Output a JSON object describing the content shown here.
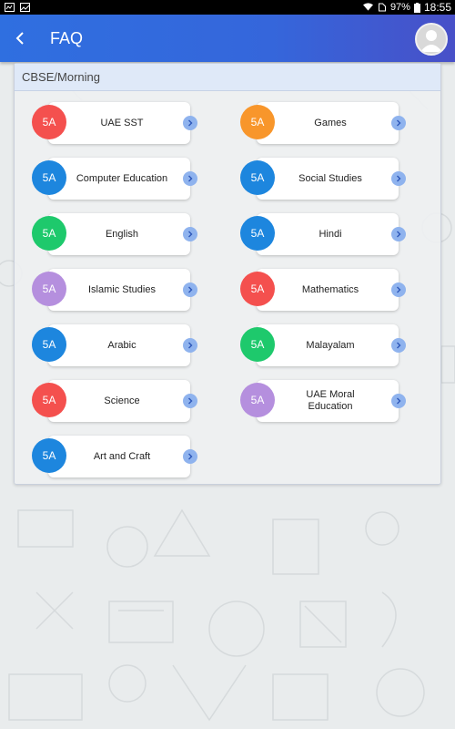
{
  "status_bar": {
    "battery": "97%",
    "time": "18:55"
  },
  "header": {
    "title": "FAQ"
  },
  "section": {
    "title": "CBSE/Morning"
  },
  "subjects": [
    {
      "class": "5A",
      "name": "UAE SST",
      "color": "#f4504e"
    },
    {
      "class": "5A",
      "name": "Games",
      "color": "#f8962b"
    },
    {
      "class": "5A",
      "name": "Computer Education",
      "color": "#1d86de"
    },
    {
      "class": "5A",
      "name": "Social Studies",
      "color": "#1d86de"
    },
    {
      "class": "5A",
      "name": "English",
      "color": "#1ec96c"
    },
    {
      "class": "5A",
      "name": "Hindi",
      "color": "#1d86de"
    },
    {
      "class": "5A",
      "name": "Islamic Studies",
      "color": "#b58fde"
    },
    {
      "class": "5A",
      "name": "Mathematics",
      "color": "#f4504e"
    },
    {
      "class": "5A",
      "name": "Arabic",
      "color": "#1d86de"
    },
    {
      "class": "5A",
      "name": "Malayalam",
      "color": "#1ec96c"
    },
    {
      "class": "5A",
      "name": "Science",
      "color": "#f4504e"
    },
    {
      "class": "5A",
      "name": "UAE Moral Education",
      "color": "#b58fde"
    },
    {
      "class": "5A",
      "name": "Art and Craft",
      "color": "#1d86de"
    }
  ]
}
